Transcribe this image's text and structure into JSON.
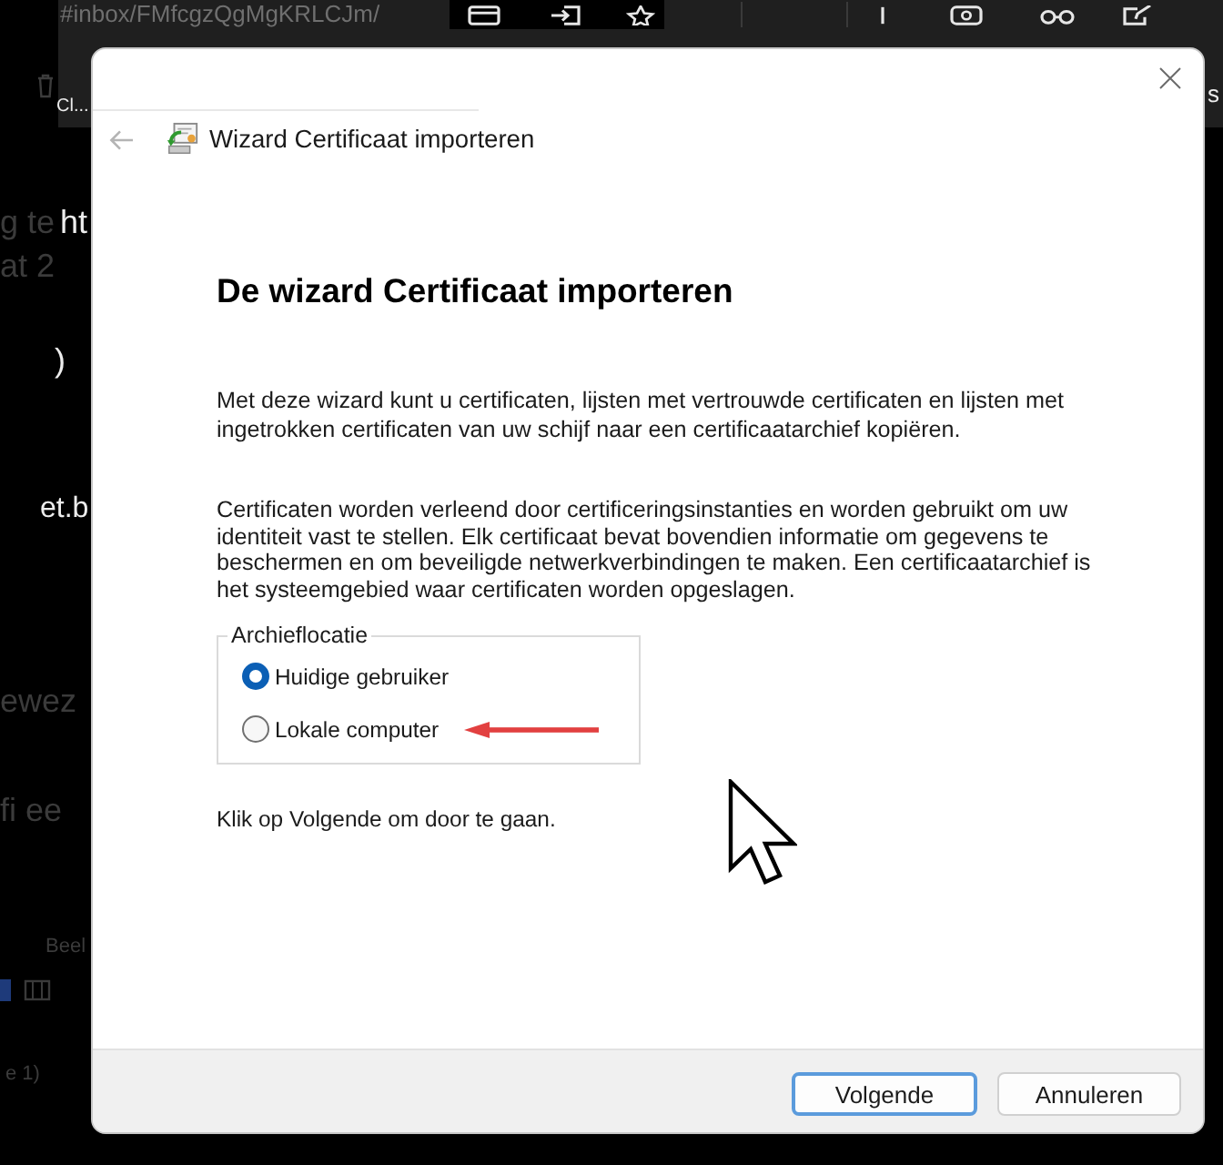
{
  "browser": {
    "url": "#inbox/FMfcgzQgMgKRLCJm/",
    "tab_title": "Cl...",
    "edge_text": "s"
  },
  "background_page": {
    "rows": [
      {
        "texts": [
          {
            "text": "g te",
            "color": "#3b3b3b"
          },
          {
            "text": "ht",
            "color": "#ededed"
          }
        ]
      },
      {
        "texts": [
          {
            "text": "at 2",
            "color": "#3b3b3b"
          }
        ]
      },
      {
        "texts": [
          {
            "text": ")",
            "color": "#ededed"
          }
        ]
      },
      {
        "texts": [
          {
            "text": "et.b",
            "color": "#ededed"
          }
        ]
      },
      {
        "texts": [
          {
            "text": "ewez",
            "color": "#3b3b3b"
          }
        ]
      },
      {
        "texts": [
          {
            "text": "fi ee",
            "color": "#3b3b3b"
          }
        ]
      },
      {
        "texts": [
          {
            "text": "Beel",
            "color": "#3b3b3b"
          }
        ]
      },
      {
        "texts": [
          {
            "text": "e 1)",
            "color": "#3b3b3b"
          }
        ]
      }
    ]
  },
  "dialog": {
    "back_button": {
      "disabled": true
    },
    "nav_title": "Wizard Certificaat importeren",
    "heading": "De wizard Certificaat importeren",
    "paragraphs": [
      "Met deze wizard kunt u certificaten, lijsten met vertrouwde certificaten en lijsten met ingetrokken certificaten van uw schijf naar een certificaatarchief kopiëren.",
      "Certificaten worden verleend door certificeringsinstanties en worden gebruikt om uw identiteit vast te stellen. Elk certificaat bevat bovendien informatie om gegevens te beschermen en om beveiligde netwerkverbindingen te maken. Een certificaatarchief is het systeemgebied waar certificaten worden opgeslagen."
    ],
    "location": {
      "legend": "Archieflocatie",
      "options": [
        {
          "label": "Huidige gebruiker",
          "selected": true,
          "marked": false
        },
        {
          "label": "Lokale computer",
          "selected": false,
          "marked": true
        }
      ]
    },
    "instruction": "Klik op Volgende om door te gaan.",
    "buttons": [
      {
        "label": "Volgende",
        "default": true
      },
      {
        "label": "Annuleren",
        "default": false
      }
    ]
  }
}
